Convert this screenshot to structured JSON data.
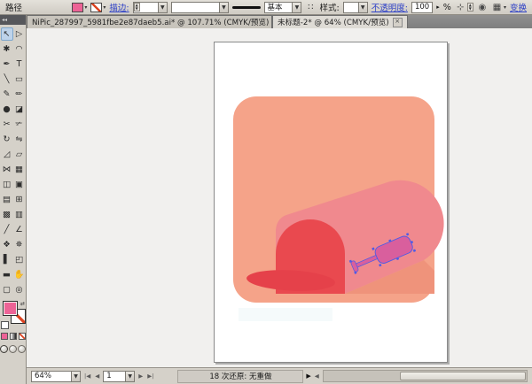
{
  "control_bar": {
    "selection_type": "路径",
    "fill_color": "#ED6396",
    "stroke_label": "描边:",
    "brush_value": "基本",
    "brush_options_icon": "∷",
    "style_label": "样式:",
    "opacity_label": "不透明度:",
    "opacity_value": "100",
    "opacity_stepper": "▸",
    "opacity_unit": "%",
    "recolor_icon": "◉",
    "align_icon": "⊹",
    "raster_icon": "▦",
    "transform_label": "变换"
  },
  "tabs": [
    {
      "label": "NiPic_287997_5981fbe2e87daeb5.ai* @ 107.71% (CMYK/预览)",
      "close": "×",
      "active": false
    },
    {
      "label": "未标题-2* @ 64% (CMYK/预览)",
      "close": "×",
      "active": true
    }
  ],
  "toolbar": {
    "collapse_icon": "◂◂",
    "selected": "selection",
    "swap_icon": "⇄",
    "tools": [
      {
        "n": "selection",
        "g": "↖"
      },
      {
        "n": "direct-selection",
        "g": "▷"
      },
      {
        "n": "magic-wand",
        "g": "✱"
      },
      {
        "n": "lasso",
        "g": "◠"
      },
      {
        "n": "pen",
        "g": "✒"
      },
      {
        "n": "type",
        "g": "T"
      },
      {
        "n": "line-segment",
        "g": "╲"
      },
      {
        "n": "rectangle",
        "g": "▭"
      },
      {
        "n": "paintbrush",
        "g": "✎"
      },
      {
        "n": "pencil",
        "g": "✏"
      },
      {
        "n": "blob-brush",
        "g": "●"
      },
      {
        "n": "eraser",
        "g": "◪"
      },
      {
        "n": "scissors",
        "g": "✂"
      },
      {
        "n": "knife",
        "g": "✃"
      },
      {
        "n": "rotate",
        "g": "↻"
      },
      {
        "n": "reflect",
        "g": "⇋"
      },
      {
        "n": "scale",
        "g": "◿"
      },
      {
        "n": "shear",
        "g": "▱"
      },
      {
        "n": "width",
        "g": "⋈"
      },
      {
        "n": "free-transform",
        "g": "▦"
      },
      {
        "n": "shape-builder",
        "g": "◫"
      },
      {
        "n": "live-paint-bucket",
        "g": "▣"
      },
      {
        "n": "live-paint-selection",
        "g": "▤"
      },
      {
        "n": "perspective-grid",
        "g": "⊞"
      },
      {
        "n": "mesh",
        "g": "▩"
      },
      {
        "n": "gradient",
        "g": "▥"
      },
      {
        "n": "eyedropper",
        "g": "╱"
      },
      {
        "n": "measure",
        "g": "∠"
      },
      {
        "n": "blend",
        "g": "❖"
      },
      {
        "n": "symbol-sprayer",
        "g": "✵"
      },
      {
        "n": "column-graph",
        "g": "▌"
      },
      {
        "n": "artboard",
        "g": "◰"
      },
      {
        "n": "slice",
        "g": "▬"
      },
      {
        "n": "hand",
        "g": "✋"
      },
      {
        "n": "print-tiling",
        "g": "▢"
      },
      {
        "n": "zoom",
        "g": "◎"
      }
    ]
  },
  "statusbar": {
    "zoom_value": "64%",
    "first_page": "|◀",
    "prev_page": "◀",
    "artboard_value": "1",
    "next_page": "▶",
    "last_page": "▶|",
    "status_text": "18 次还原: 无重做",
    "status_menu_arrow": "▶",
    "scroll_left_arrow": "◀"
  },
  "artwork": {
    "colors": {
      "background": "#F5A389",
      "body": "#F0898E",
      "front": "#E9494F",
      "door": "#E5414A",
      "shadow": "#EF937B",
      "band": "#EDF5F8",
      "handle": "#D95F9D",
      "anchor": "#4E5BE6"
    },
    "handle_anchors": [
      [
        -2,
        -7
      ],
      [
        -2,
        7
      ],
      [
        27,
        -10
      ],
      [
        48,
        -11
      ],
      [
        69,
        -10
      ],
      [
        70,
        0
      ],
      [
        69,
        10
      ],
      [
        48,
        11
      ],
      [
        27,
        10
      ]
    ]
  }
}
